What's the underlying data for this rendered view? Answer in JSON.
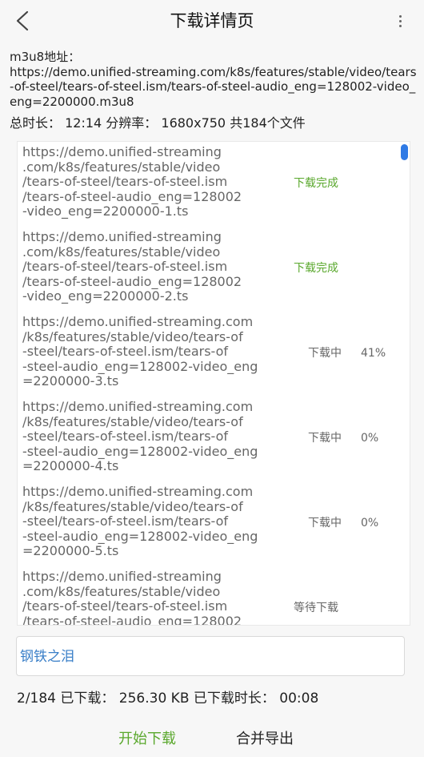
{
  "header": {
    "title": "下载详情页",
    "back_icon": "back-arrow-icon",
    "more_icon": "more-vertical-icon"
  },
  "m3u8": {
    "label": "m3u8地址：",
    "url": "https://demo.unified-streaming.com/k8s/features/stable/video/tears-of-steel/tears-of-steel.ism/tears-of-steel-audio_eng=128002-video_eng=2200000.m3u8"
  },
  "summary": {
    "duration": "总时长：  12:14",
    "resolution": "分辨率：  1680x750",
    "file_count": "共184个文件"
  },
  "files": [
    {
      "url": "https://demo.unified-streaming\n.com/k8s/features/stable/video\n/tears-of-steel/tears-of-steel.ism\n/tears-of-steel-audio_eng=128002\n-video_eng=2200000-1.ts",
      "status": "下载完成",
      "progress": ""
    },
    {
      "url": "https://demo.unified-streaming\n.com/k8s/features/stable/video\n/tears-of-steel/tears-of-steel.ism\n/tears-of-steel-audio_eng=128002\n-video_eng=2200000-2.ts",
      "status": "下载完成",
      "progress": ""
    },
    {
      "url": "https://demo.unified-streaming.com\n/k8s/features/stable/video/tears-of\n-steel/tears-of-steel.ism/tears-of\n-steel-audio_eng=128002-video_eng\n=2200000-3.ts",
      "status": "下载中",
      "progress": "41%"
    },
    {
      "url": "https://demo.unified-streaming.com\n/k8s/features/stable/video/tears-of\n-steel/tears-of-steel.ism/tears-of\n-steel-audio_eng=128002-video_eng\n=2200000-4.ts",
      "status": "下载中",
      "progress": "0%"
    },
    {
      "url": "https://demo.unified-streaming.com\n/k8s/features/stable/video/tears-of\n-steel/tears-of-steel.ism/tears-of\n-steel-audio_eng=128002-video_eng\n=2200000-5.ts",
      "status": "下载中",
      "progress": "0%"
    },
    {
      "url": "https://demo.unified-streaming\n.com/k8s/features/stable/video\n/tears-of-steel/tears-of-steel.ism\n/tears-of-steel-audio_eng=128002",
      "status": "等待下载",
      "progress": ""
    }
  ],
  "name_field": {
    "value": "钢铁之泪"
  },
  "stats": {
    "text": "2/184  已下载：  256.30 KB  已下载时长：  00:08"
  },
  "actions": {
    "start_label": "开始下载",
    "merge_label": "合并导出"
  },
  "colors": {
    "done": "#5aa82d",
    "accent_blue": "#2f7ae5",
    "name_text": "#3a7fc8"
  }
}
